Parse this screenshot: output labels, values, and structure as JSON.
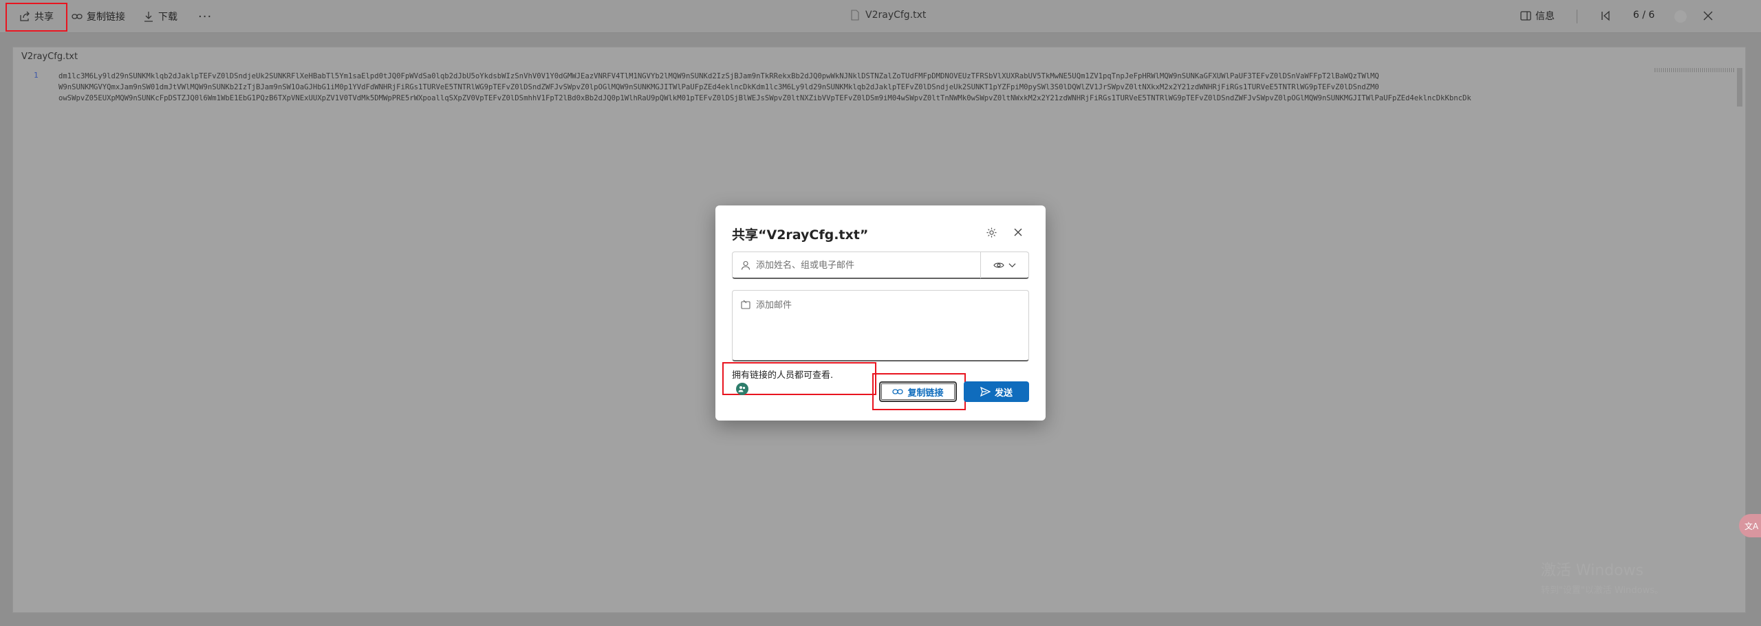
{
  "toolbar": {
    "share_label": "共享",
    "copy_link_label": "复制链接",
    "download_label": "下载",
    "more_label": "···",
    "file_title": "V2rayCfg.txt",
    "info_label": "信息",
    "page_indicator": "6 / 6"
  },
  "document": {
    "file_name": "V2rayCfg.txt",
    "line_number": "1",
    "lines": [
      "dm1lc3M6Ly9ld29nSUNKMklqb2dJaklpTEFvZ0lDSndjeUk2SUNKRFlXeHBabTl5Ym1saElpd0tJQ0FpWVdSa0lqb2dJbU5oYkdsbWIzSnVhV0V1Y0dGMWJEazVNRFV4TlM1NGVYb2lMQW9nSUNKd2IzSjBJam9nTkRRekxBb2dJQ0pwWkNJNklDSTNZalZoTUdFMFpDMDNOVEUzTFRSbVlXUXRabUV5TkMwNE5UQm1ZV1pqTnpJeFpHRWlMQW9nSUNKaGFXUWlPaUF3TEFvZ0lDSnVaWFFpT2lBaWQzTWlMQ",
      "W9nSUNKMGVYQmxJam9nSW01dmJtVWlMQW9nSUNKb2IzTjBJam9nSW1OaGJHbG1iM0p1YVdFdWNHRjFiRGs1TURVeE5TNTRlWG9pTEFvZ0lDSndZWFJvSWpvZ0lpOGlMQW9nSUNKMGJITWlPaUFpZEd4eklncDkKdm1lc3M6Ly9ld29nSUNKMklqb2dJaklpTEFvZ0lDSndjeUk2SUNKT1pYZFpiM0pySWl3S0lDQWlZV1JrSWpvZ0ltNXkxM2x2Y21zdWNHRjFiRGs1TURVeE5TNTRlWG9pTEFvZ0lDSndZM0",
      "owSWpvZ05EUXpMQW9nSUNKcFpDSTZJQ0l6Wm1WbE1EbG1PQzB6TXpVNExUUXpZV1V0TVdMk5DMWpPRE5rWXpoallqSXpZV0VpTEFvZ0lDSmhhV1FpT2lBd0xBb2dJQ0p1WlhRaU9pQWlkM01pTEFvZ0lDSjBlWEJsSWpvZ0ltNXZibVVpTEFvZ0lDSm9iM04wSWpvZ0ltTnNWMk0wSWpvZ0ltNWxkM2x2Y21zdWNHRjFiRGs1TURVeE5TNTRlWG9pTEFvZ0lDSndZWFJvSWpvZ0lpOGlMQW9nSUNKMGJITWlPaUFpZEd4eklncDkKbncDk"
    ]
  },
  "dialog": {
    "title": "共享“V2rayCfg.txt”",
    "recipient_placeholder": "添加姓名、组或电子邮件",
    "message_placeholder": "添加邮件",
    "link_info": "拥有链接的人员都可查看.",
    "copy_link_button": "复制链接",
    "send_button": "发送"
  },
  "watermark": {
    "line1": "激活 Windows",
    "line2": "转到\"设置\"以激活 Windows。"
  },
  "floater_label": "文A",
  "colors": {
    "accent": "#0f6cbd",
    "highlight_box": "#e8141f",
    "avatar": "#2e7d6b"
  },
  "icons": {
    "share": "share-icon",
    "link": "link-icon",
    "download": "download-icon",
    "file": "file-icon",
    "info": "info-panel-icon",
    "first_page": "first-page-icon",
    "close": "close-icon",
    "settings": "gear-icon",
    "person": "person-icon",
    "view_permission": "eye-icon",
    "message": "message-icon",
    "send": "send-icon"
  }
}
